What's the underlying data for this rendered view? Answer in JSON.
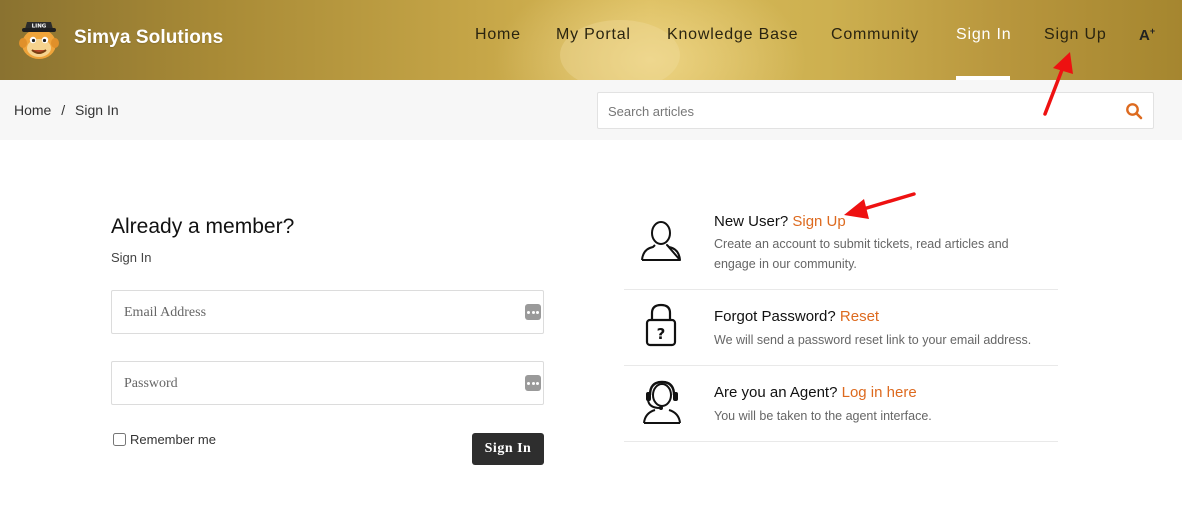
{
  "header": {
    "brand": "Simya Solutions",
    "logo_text": "LING",
    "nav": [
      {
        "label": "Home"
      },
      {
        "label": "My Portal"
      },
      {
        "label": "Knowledge Base"
      },
      {
        "label": "Community"
      },
      {
        "label": "Sign In"
      },
      {
        "label": "Sign Up"
      }
    ],
    "font_toggle": "A"
  },
  "breadcrumb": {
    "home": "Home",
    "separator": "/",
    "current": "Sign In"
  },
  "search": {
    "placeholder": "Search articles"
  },
  "login": {
    "title": "Already a member?",
    "subtitle": "Sign In",
    "email_placeholder": "Email Address",
    "password_placeholder": "Password",
    "remember_label": "Remember me",
    "submit_label": "Sign In"
  },
  "options": {
    "new_user": {
      "title": "New User?",
      "link": "Sign Up",
      "desc": "Create an account to submit tickets, read articles and engage in our community."
    },
    "forgot": {
      "title": "Forgot Password?",
      "link": "Reset",
      "desc": "We will send a password reset link to your email address."
    },
    "agent": {
      "title": "Are you an Agent?",
      "link": "Log in here",
      "desc": "You will be taken to the agent interface."
    }
  },
  "colors": {
    "accent": "#dd6a1f",
    "button": "#2e2e2e",
    "annotation": "#ee1111"
  }
}
